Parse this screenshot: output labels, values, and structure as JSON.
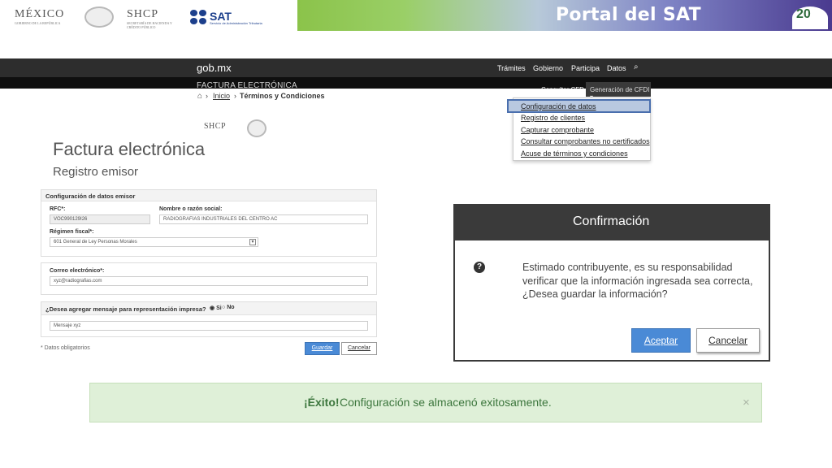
{
  "banner": {
    "title": "Portal del SAT",
    "logo_mexico": "MÉXICO",
    "logo_mexico_sub": "GOBIERNO DE LA REPÚBLICA",
    "logo_shcp": "SHCP",
    "logo_shcp_sub": "SECRETARÍA DE HACIENDA Y CRÉDITO PÚBLICO",
    "logo_sat": "SAT",
    "logo_sat_sub": "Servicio de Administración Tributaria",
    "badge": "20"
  },
  "nav": {
    "brand": "gob.mx",
    "links": [
      "Trámites",
      "Gobierno",
      "Participa",
      "Datos"
    ],
    "subtitle": "FACTURA ELECTRÓNICA",
    "consultar": "Consultar CFD",
    "generacion": "Generación de CFDI ▾"
  },
  "dropdown": {
    "items": [
      "Configuración de datos",
      "Registro de clientes",
      "Capturar comprobante",
      "Consultar comprobantes no certificados",
      "Acuse de términos y condiciones"
    ]
  },
  "breadcrumb": {
    "inicio": "Inicio",
    "current": "Términos y Condiciones",
    "sep": "›"
  },
  "small_logo": "SHCP",
  "page": {
    "title": "Factura electrónica",
    "subtitle": "Registro emisor"
  },
  "form": {
    "section1_title": "Configuración de datos emisor",
    "rfc_label": "RFC*:",
    "rfc_value": "VOC990129I26",
    "razon_label": "Nombre o razón social:",
    "razon_value": "RADIOGRAFIAS INDUSTRIALES DEL CENTRO AC",
    "regimen_label": "Régimen fiscal*:",
    "regimen_value": "601 General de Ley Personas Morales",
    "email_label": "Correo electrónico*:",
    "email_value": "xyz@radiografias.com",
    "mensaje_question": "¿Desea agregar mensaje para representación impresa?",
    "si_label": "Si",
    "no_label": "No",
    "mensaje_value": "Mensaje xyz",
    "obligatorios": "* Datos obligatorios",
    "guardar": "Guardar",
    "cancelar": "Cancelar"
  },
  "dialog": {
    "title": "Confirmación",
    "line1": "Estimado contribuyente, es su responsabilidad",
    "line2": "verificar que la información ingresada sea correcta,",
    "line3": "¿Desea guardar la información?",
    "aceptar": "Aceptar",
    "cancelar": "Cancelar"
  },
  "alert": {
    "strong": "¡Éxito!",
    "message": "Configuración se almacenó exitosamente.",
    "close": "×"
  }
}
